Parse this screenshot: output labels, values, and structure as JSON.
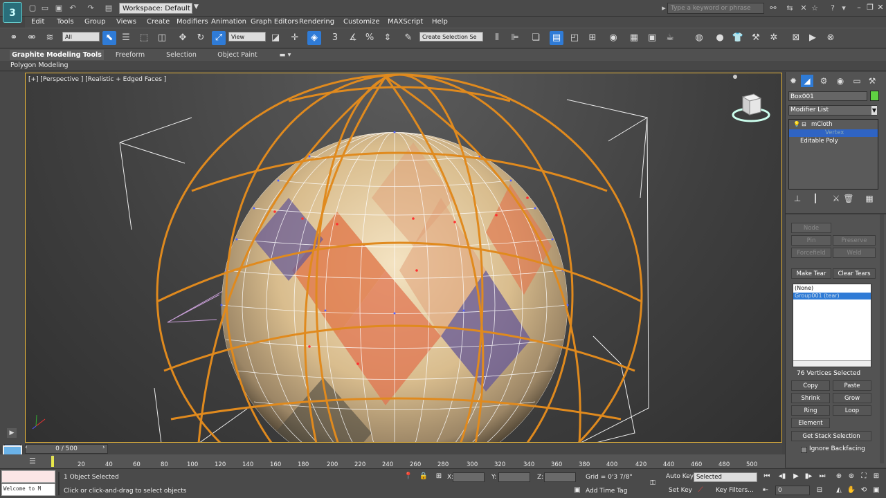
{
  "titlebar": {
    "workspace": "Workspace: Default",
    "title": "",
    "search_placeholder": "Type a keyword or phrase"
  },
  "menu": [
    "Edit",
    "Tools",
    "Group",
    "Views",
    "Create",
    "Modifiers",
    "Animation",
    "Graph Editors",
    "Rendering",
    "Customize",
    "MAXScript",
    "Help"
  ],
  "toolbar": {
    "filter": "All",
    "ref_coord": "View",
    "selection_set": "Create Selection Se"
  },
  "ribbon": {
    "tabs": [
      "Graphite Modeling Tools",
      "Freeform",
      "Selection",
      "Object Paint"
    ],
    "sub_label": "Polygon Modeling"
  },
  "viewport": {
    "label": "[+] [Perspective ] [Realistic + Edged Faces ]"
  },
  "colors": {
    "accent": "#2f7bd6",
    "selection_border": "#e7b53a",
    "cage": "#e08a1e",
    "object_color": "#5fd142"
  },
  "command_panel": {
    "object_name": "Box001",
    "modifier_list": "Modifier List",
    "stack": [
      "mCloth",
      "Vertex",
      "Editable Poly"
    ],
    "buttons_dim": [
      "Node",
      "Pin",
      "Preserve",
      "Forcefield",
      "Weld"
    ],
    "make_tear": "Make Tear",
    "clear_tears": "Clear Tears",
    "groups": [
      "(None)",
      "Group001 (tear)"
    ],
    "vertex_count": "76 Vertices Selected",
    "copy": "Copy",
    "paste": "Paste",
    "shrink": "Shrink",
    "grow": "Grow",
    "ring": "Ring",
    "loop": "Loop",
    "element": "Element",
    "get_stack_selection": "Get Stack Selection",
    "ignore_backfacing": "Ignore Backfacing"
  },
  "timeline": {
    "frame": "0 / 500",
    "ticks": [
      "20",
      "40",
      "60",
      "80",
      "100",
      "120",
      "140",
      "160",
      "180",
      "200",
      "220",
      "240",
      "260",
      "280",
      "300",
      "320",
      "340",
      "360",
      "380",
      "400",
      "420",
      "440",
      "460",
      "480",
      "500"
    ]
  },
  "statusbar": {
    "maxscript": "Welcome to M",
    "selected": "1 Object Selected",
    "prompt": "Click or click-and-drag to select objects",
    "x_label": "X:",
    "y_label": "Y:",
    "z_label": "Z:",
    "grid": "Grid = 0'3 7/8\"",
    "add_time_tag": "Add Time Tag",
    "auto_key": "Auto Key",
    "auto_key_value": "Selected",
    "set_key": "Set Key",
    "key_filters": "Key Filters...",
    "current_frame": "0"
  }
}
